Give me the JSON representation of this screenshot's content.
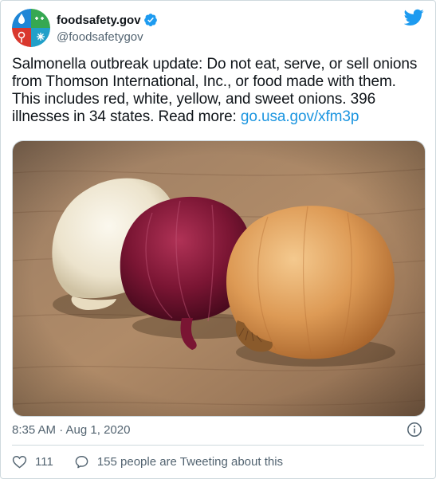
{
  "account": {
    "name": "foodsafety.gov",
    "handle": "@foodsafetygov"
  },
  "tweet": {
    "text_main": "Salmonella outbreak update: Do not eat, serve, or sell onions from Thomson International, Inc., or food made with them. This includes red, white, yellow, and sweet onions. 396 illnesses in 34 states. Read more: ",
    "link": "go.usa.gov/xfm3p",
    "timestamp": "8:35 AM · Aug 1, 2020",
    "likes": "111",
    "tweeting_text": "155 people are Tweeting about this"
  },
  "media": {
    "alt": "",
    "subject": [
      "white onion",
      "red onion",
      "yellow onion"
    ]
  },
  "icons": {
    "verified": "verified-badge-icon",
    "brand": "twitter-bird-icon",
    "info": "info-icon",
    "like": "heart-icon",
    "reply": "speech-bubble-icon"
  },
  "colors": {
    "link": "#1b95e0",
    "verified": "#1d9bf0",
    "twitter_blue": "#1d9bf0",
    "secondary_text": "#536471"
  }
}
